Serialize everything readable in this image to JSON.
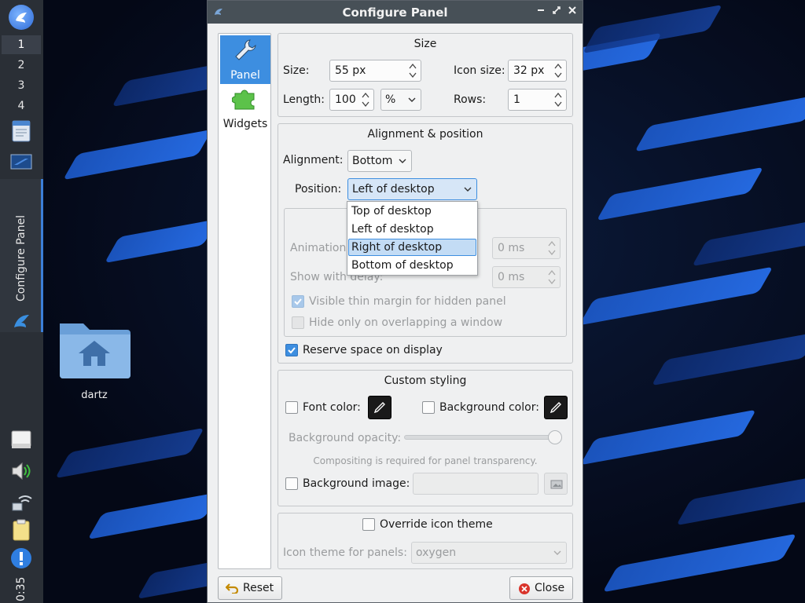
{
  "taskbar": {
    "desktops": [
      "1",
      "2",
      "3",
      "4"
    ],
    "active_window_label": "Configure Panel",
    "clock": "0:35"
  },
  "desktop": {
    "folder_label": "dartz"
  },
  "dialog": {
    "title": "Configure Panel",
    "sidebar": [
      {
        "label": "Panel",
        "icon": "wrench-icon"
      },
      {
        "label": "Widgets",
        "icon": "puzzle-icon"
      }
    ],
    "size_group": {
      "title": "Size",
      "size_label": "Size:",
      "size_value": "55 px",
      "icon_size_label": "Icon size:",
      "icon_size_value": "32 px",
      "length_label": "Length:",
      "length_value": "100",
      "length_unit": "%",
      "rows_label": "Rows:",
      "rows_value": "1"
    },
    "alignment_group": {
      "title": "Alignment & position",
      "alignment_label": "Alignment:",
      "alignment_value": "Bottom",
      "position_label": "Position:",
      "position_value": "Left of desktop",
      "position_options": [
        "Top of desktop",
        "Left of desktop",
        "Right of desktop",
        "Bottom of desktop"
      ],
      "highlighted_option": "Right of desktop",
      "animation_label": "Animation",
      "animation_value": "0 ms",
      "show_delay_label": "Show with delay:",
      "show_delay_value": "0 ms",
      "thin_margin_label": "Visible thin margin for hidden panel",
      "hide_overlap_label": "Hide only on overlapping a window",
      "reserve_space_label": "Reserve space on display"
    },
    "styling_group": {
      "title": "Custom styling",
      "font_color_label": "Font color:",
      "bg_color_label": "Background color:",
      "bg_opacity_label": "Background opacity:",
      "compositing_note": "Compositing is required for panel transparency.",
      "bg_image_label": "Background image:"
    },
    "icon_theme_group": {
      "override_label": "Override icon theme",
      "theme_label": "Icon theme for panels:",
      "theme_value": "oxygen"
    },
    "buttons": {
      "reset": "Reset",
      "close": "Close"
    }
  }
}
